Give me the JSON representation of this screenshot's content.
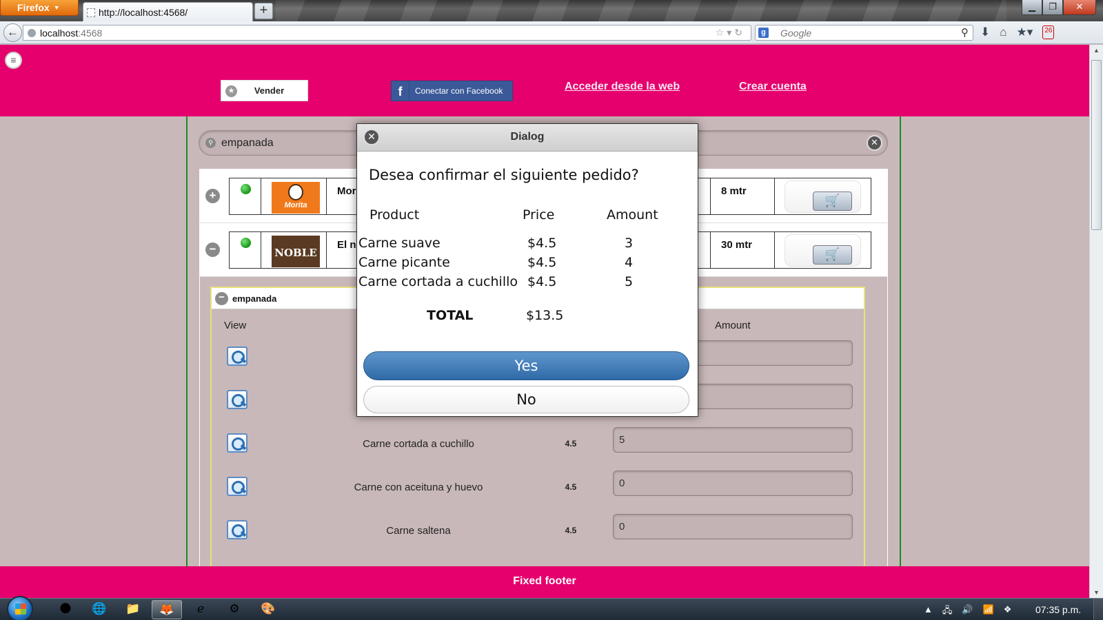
{
  "browser": {
    "menu_label": "Firefox",
    "tab_title": "http://localhost:4568/",
    "url_host": "localhost",
    "url_port": ":4568",
    "search_placeholder": "Google",
    "badge_count": "26"
  },
  "header": {
    "vender_label": "Vender",
    "facebook_label": "Conectar con Facebook",
    "web_link": "Acceder desde la web",
    "create_link": "Crear cuenta"
  },
  "search": {
    "value": "empanada"
  },
  "stores": [
    {
      "name": "Mor",
      "logo_text": "Morita",
      "distance": "8 mtr",
      "expand_icon": "plus"
    },
    {
      "name": "El n",
      "logo_text": "NOBLE",
      "distance": "30 mtr",
      "expand_icon": "minus"
    }
  ],
  "category": {
    "title": "empanada",
    "col_view": "View",
    "col_amount": "Amount",
    "products": [
      {
        "name": "",
        "price": "",
        "amount": ""
      },
      {
        "name": "",
        "price": "",
        "amount": ""
      },
      {
        "name": "Carne cortada a cuchillo",
        "price": "4.5",
        "amount": "5"
      },
      {
        "name": "Carne con aceituna y huevo",
        "price": "4.5",
        "amount": "0"
      },
      {
        "name": "Carne saltena",
        "price": "4.5",
        "amount": "0"
      }
    ]
  },
  "footer": {
    "text": "Fixed footer"
  },
  "dialog": {
    "title": "Dialog",
    "question": "Desea confirmar el siguiente pedido?",
    "headers": {
      "product": "Product",
      "price": "Price",
      "amount": "Amount"
    },
    "rows": [
      {
        "product": "Carne suave",
        "price": "$4.5",
        "amount": "3"
      },
      {
        "product": "Carne picante",
        "price": "$4.5",
        "amount": "4"
      },
      {
        "product": "Carne cortada a cuchillo",
        "price": "$4.5",
        "amount": "5"
      }
    ],
    "total_label": "TOTAL",
    "total_value": "$13.5",
    "yes_label": "Yes",
    "no_label": "No"
  },
  "taskbar": {
    "clock": "07:35 p.m."
  },
  "colors": {
    "header_pink": "#e5006d",
    "page_bg": "#c9b8b9",
    "yes_blue": "#2f6aa8",
    "facebook_blue": "#3b5998"
  },
  "icons": [
    "menu-icon",
    "star-icon",
    "facebook-icon",
    "search-icon",
    "clear-icon",
    "plus-icon",
    "minus-icon",
    "status-dot-icon",
    "cart-icon",
    "zoom-icon",
    "close-icon"
  ]
}
